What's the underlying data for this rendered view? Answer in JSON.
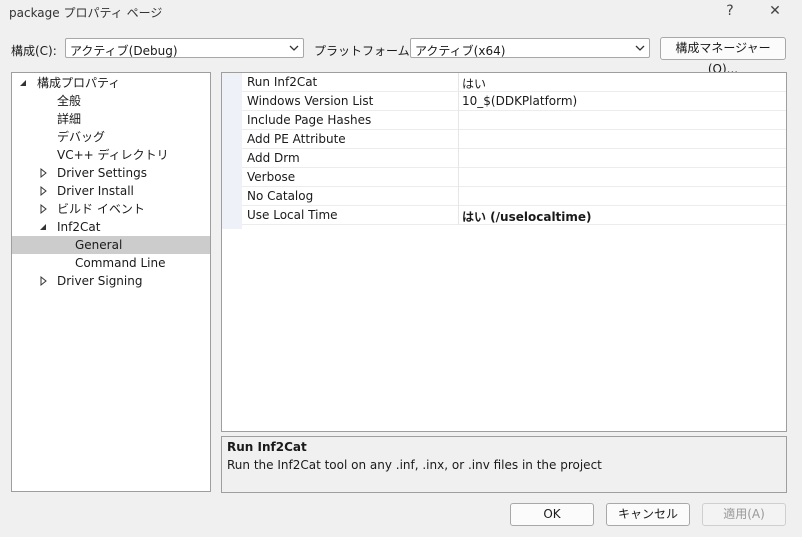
{
  "window": {
    "title": "package プロパティ ページ",
    "help_glyph": "?",
    "close_glyph": "✕"
  },
  "config": {
    "label": "構成(C):",
    "value": "アクティブ(Debug)"
  },
  "platform": {
    "label": "プラットフォーム(P):",
    "value": "アクティブ(x64)"
  },
  "config_manager_label": "構成マネージャー(O)...",
  "tree": {
    "items": [
      {
        "label": "構成プロパティ",
        "expander": "expanded",
        "level": 0
      },
      {
        "label": "全般",
        "expander": "none",
        "level": 1
      },
      {
        "label": "詳細",
        "expander": "none",
        "level": 1
      },
      {
        "label": "デバッグ",
        "expander": "none",
        "level": 1
      },
      {
        "label": "VC++ ディレクトリ",
        "expander": "none",
        "level": 1
      },
      {
        "label": "Driver Settings",
        "expander": "collapsed",
        "level": 1
      },
      {
        "label": "Driver Install",
        "expander": "collapsed",
        "level": 1
      },
      {
        "label": "ビルド イベント",
        "expander": "collapsed",
        "level": 1
      },
      {
        "label": "Inf2Cat",
        "expander": "expanded",
        "level": 1
      },
      {
        "label": "General",
        "expander": "none",
        "level": 2,
        "selected": true
      },
      {
        "label": "Command Line",
        "expander": "none",
        "level": 2
      },
      {
        "label": "Driver Signing",
        "expander": "collapsed",
        "level": 1
      }
    ]
  },
  "properties": [
    {
      "name": "Run Inf2Cat",
      "value": "はい",
      "bold": false
    },
    {
      "name": "Windows Version List",
      "value": "10_$(DDKPlatform)",
      "bold": false
    },
    {
      "name": "Include Page Hashes",
      "value": "",
      "bold": false
    },
    {
      "name": "Add PE Attribute",
      "value": "",
      "bold": false
    },
    {
      "name": "Add Drm",
      "value": "",
      "bold": false
    },
    {
      "name": "Verbose",
      "value": "",
      "bold": false
    },
    {
      "name": "No Catalog",
      "value": "",
      "bold": false
    },
    {
      "name": "Use Local Time",
      "value": "はい (/uselocaltime)",
      "bold": true
    }
  ],
  "description": {
    "title": "Run Inf2Cat",
    "text": "Run the Inf2Cat tool on any .inf, .inx, or .inv files in the project"
  },
  "buttons": {
    "ok": "OK",
    "cancel": "キャンセル",
    "apply": "適用(A)"
  },
  "colors": {
    "selection": "#cccccc",
    "gutter": "#eef2f8"
  }
}
